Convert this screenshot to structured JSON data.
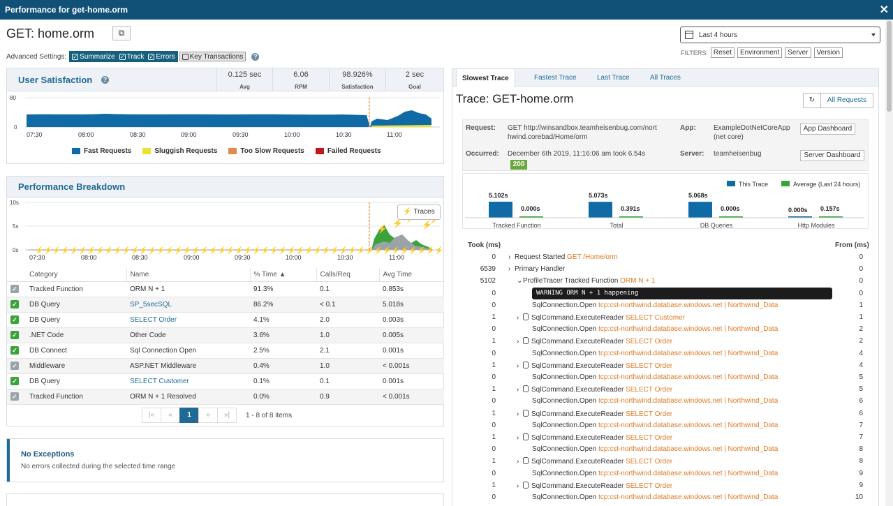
{
  "window": {
    "title": "Performance for get-home.orm"
  },
  "page": {
    "title": "GET: home.orm"
  },
  "advanced": {
    "label": "Advanced Settings:",
    "toggles": [
      {
        "label": "Summarize",
        "on": true
      },
      {
        "label": "Track",
        "on": true
      },
      {
        "label": "Errors",
        "on": true
      },
      {
        "label": "Key Transactions",
        "on": false
      }
    ]
  },
  "time_range": {
    "selected": "Last 4 hours"
  },
  "filters": {
    "label": "FILTERS:",
    "buttons": [
      "Reset",
      "Environment",
      "Server",
      "Version"
    ]
  },
  "user_satisfaction": {
    "title": "User Satisfaction",
    "stats": [
      {
        "value": "0.125 sec",
        "label": "Avg"
      },
      {
        "value": "6.06",
        "label": "RPM"
      },
      {
        "value": "98.926%",
        "label": "Satisfaction"
      },
      {
        "value": "2 sec",
        "label": "Goal"
      }
    ]
  },
  "us_chart": {
    "chart_data": {
      "type": "area",
      "y_ticks": [
        "80",
        "0"
      ],
      "x_ticks": [
        "07:30",
        "08:00",
        "08:30",
        "09:00",
        "09:30",
        "10:00",
        "10:30",
        "11:00"
      ],
      "legend": [
        {
          "name": "Fast Requests",
          "color": "#0f6aa5"
        },
        {
          "name": "Sluggish Requests",
          "color": "#e8e430"
        },
        {
          "name": "Too Slow Requests",
          "color": "#e38b4c"
        },
        {
          "name": "Failed Requests",
          "color": "#c0161d"
        }
      ]
    }
  },
  "performance_breakdown": {
    "title": "Performance Breakdown",
    "traces_button": "Traces",
    "chart_data": {
      "type": "area",
      "y_ticks": [
        "10s",
        "5s",
        "0s"
      ],
      "x_ticks": [
        "07:30",
        "08:00",
        "08:30",
        "09:00",
        "09:30",
        "10:00",
        "10:30",
        "11:00"
      ]
    },
    "columns": [
      "Category",
      "Name",
      "% Time ▲",
      "Calls/Req",
      "Avg Time"
    ],
    "rows": [
      {
        "checked": false,
        "category": "Tracked Function",
        "name": "ORM N + 1",
        "link": false,
        "pct": "91.3%",
        "calls": "0.1",
        "avg": "0.853s"
      },
      {
        "checked": true,
        "category": "DB Query",
        "name": "SP_5secSQL",
        "link": true,
        "pct": "86.2%",
        "calls": "< 0.1",
        "avg": "5.018s"
      },
      {
        "checked": true,
        "category": "DB Query",
        "name": "SELECT Order",
        "link": true,
        "pct": "4.1%",
        "calls": "2.0",
        "avg": "0.003s"
      },
      {
        "checked": true,
        "category": ".NET Code",
        "name": "Other Code",
        "link": false,
        "pct": "3.6%",
        "calls": "1.0",
        "avg": "0.005s"
      },
      {
        "checked": true,
        "category": "DB Connect",
        "name": "Sql Connection Open",
        "link": false,
        "pct": "2.5%",
        "calls": "2.1",
        "avg": "0.001s"
      },
      {
        "checked": false,
        "category": "Middleware",
        "name": "ASP.NET Middleware",
        "link": false,
        "pct": "0.4%",
        "calls": "1.0",
        "avg": "< 0.001s"
      },
      {
        "checked": true,
        "category": "DB Query",
        "name": "SELECT Customer",
        "link": true,
        "pct": "0.1%",
        "calls": "0.1",
        "avg": "0.001s"
      },
      {
        "checked": false,
        "category": "Tracked Function",
        "name": "ORM N + 1 Resolved",
        "link": false,
        "pct": "0.0%",
        "calls": "0.9",
        "avg": "< 0.001s"
      }
    ],
    "pager": {
      "first": "|«",
      "prev": "«",
      "current": "1",
      "next": "»",
      "last": "»|",
      "summary": "1 - 8 of 8 items"
    }
  },
  "exceptions": {
    "title": "No Exceptions",
    "message": "No errors collected during the selected time range"
  },
  "trace_tabs": [
    "Slowest Trace",
    "Fastest Trace",
    "Last Trace",
    "All Traces"
  ],
  "trace": {
    "title": "Trace: GET-home.orm",
    "all_requests": "All Requests",
    "request_label": "Request:",
    "request_value": "GET http://winsandbox.teamheisenbug.com/northwind.corebad/Home/orm",
    "request_line1": "GET http://winsandbox.teamheisenbug.com/nort",
    "request_line2": "hwind.corebad/Home/orm",
    "app_label": "App:",
    "app_line1": "ExampleDotNetCoreApp",
    "app_line2": "(net core)",
    "app_dashboard": "App Dashboard",
    "occurred_label": "Occurred:",
    "occurred_value": "December 6th 2019, 11:16:06 am took 6.54s",
    "status": "200",
    "server_label": "Server:",
    "server_value": "teamheisenbug",
    "server_dashboard": "Server Dashboard"
  },
  "compare_chart": {
    "chart_data": {
      "type": "bar",
      "categories": [
        "Tracked Function",
        "Total",
        "DB Queries",
        "Http Modules"
      ],
      "series": [
        {
          "name": "This Trace",
          "color": "#0f6aa5",
          "values": [
            5.102,
            5.073,
            5.068,
            0.0
          ],
          "labels": [
            "5.102s",
            "5.073s",
            "5.068s",
            "0.000s"
          ]
        },
        {
          "name": "Average (Last 24 hours)",
          "color": "#3aa33a",
          "values": [
            0.0,
            0.391,
            0.0,
            0.157
          ],
          "labels": [
            "0.000s",
            "0.391s",
            "0.000s",
            "0.157s"
          ]
        }
      ]
    }
  },
  "trace_table": {
    "took_header": "Took (ms)",
    "from_header": "From (ms)",
    "rows": [
      {
        "took": "0",
        "indent": 0,
        "chev": "›",
        "db": false,
        "name": "Request Started",
        "detail": "GET /Home/orm",
        "from": "0"
      },
      {
        "took": "6539",
        "indent": 0,
        "chev": "›",
        "db": false,
        "name": "Primary Handler",
        "detail": "",
        "from": "0"
      },
      {
        "took": "5102",
        "indent": 1,
        "chev": "⌄",
        "db": false,
        "name": "ProfileTracer Tracked Function",
        "detail": "ORM N + 1",
        "from": "0"
      },
      {
        "took": "0",
        "indent": 2,
        "chev": "",
        "db": false,
        "name": "",
        "detail": "",
        "from": "0",
        "warning": "WARNING ORM N + 1 happening"
      },
      {
        "took": "0",
        "indent": 2,
        "chev": "",
        "db": false,
        "name": "SqlConnection.Open",
        "detail": "tcp:cst-northwind.database.windows.net | Northwind_Data",
        "from": "1"
      },
      {
        "took": "1",
        "indent": 1,
        "chev": "›",
        "db": true,
        "name": "SqlCommand.ExecuteReader",
        "detail": "SELECT Customer",
        "from": "1"
      },
      {
        "took": "0",
        "indent": 2,
        "chev": "",
        "db": false,
        "name": "SqlConnection.Open",
        "detail": "tcp:cst-northwind.database.windows.net | Northwind_Data",
        "from": "2"
      },
      {
        "took": "1",
        "indent": 1,
        "chev": "›",
        "db": true,
        "name": "SqlCommand.ExecuteReader",
        "detail": "SELECT Order",
        "from": "2"
      },
      {
        "took": "0",
        "indent": 2,
        "chev": "",
        "db": false,
        "name": "SqlConnection.Open",
        "detail": "tcp:cst-northwind.database.windows.net | Northwind_Data",
        "from": "4"
      },
      {
        "took": "1",
        "indent": 1,
        "chev": "›",
        "db": true,
        "name": "SqlCommand.ExecuteReader",
        "detail": "SELECT Order",
        "from": "4"
      },
      {
        "took": "0",
        "indent": 2,
        "chev": "",
        "db": false,
        "name": "SqlConnection.Open",
        "detail": "tcp:cst-northwind.database.windows.net | Northwind_Data",
        "from": "5"
      },
      {
        "took": "1",
        "indent": 1,
        "chev": "›",
        "db": true,
        "name": "SqlCommand.ExecuteReader",
        "detail": "SELECT Order",
        "from": "5"
      },
      {
        "took": "0",
        "indent": 2,
        "chev": "",
        "db": false,
        "name": "SqlConnection.Open",
        "detail": "tcp:cst-northwind.database.windows.net | Northwind_Data",
        "from": "6"
      },
      {
        "took": "1",
        "indent": 1,
        "chev": "›",
        "db": true,
        "name": "SqlCommand.ExecuteReader",
        "detail": "SELECT Order",
        "from": "6"
      },
      {
        "took": "0",
        "indent": 2,
        "chev": "",
        "db": false,
        "name": "SqlConnection.Open",
        "detail": "tcp:cst-northwind.database.windows.net | Northwind_Data",
        "from": "7"
      },
      {
        "took": "1",
        "indent": 1,
        "chev": "›",
        "db": true,
        "name": "SqlCommand.ExecuteReader",
        "detail": "SELECT Order",
        "from": "7"
      },
      {
        "took": "0",
        "indent": 2,
        "chev": "",
        "db": false,
        "name": "SqlConnection.Open",
        "detail": "tcp:cst-northwind.database.windows.net | Northwind_Data",
        "from": "8"
      },
      {
        "took": "1",
        "indent": 1,
        "chev": "›",
        "db": true,
        "name": "SqlCommand.ExecuteReader",
        "detail": "SELECT Order",
        "from": "8"
      },
      {
        "took": "0",
        "indent": 2,
        "chev": "",
        "db": false,
        "name": "SqlConnection.Open",
        "detail": "tcp:cst-northwind.database.windows.net | Northwind_Data",
        "from": "9"
      },
      {
        "took": "1",
        "indent": 1,
        "chev": "›",
        "db": true,
        "name": "SqlCommand.ExecuteReader",
        "detail": "SELECT Order",
        "from": "9"
      },
      {
        "took": "0",
        "indent": 2,
        "chev": "",
        "db": false,
        "name": "SqlConnection.Open",
        "detail": "tcp:cst-northwind.database.windows.net | Northwind_Data",
        "from": "10"
      }
    ]
  },
  "colors": {
    "header": "#115077",
    "accent": "#1f6a97",
    "orange": "#e07a24"
  }
}
